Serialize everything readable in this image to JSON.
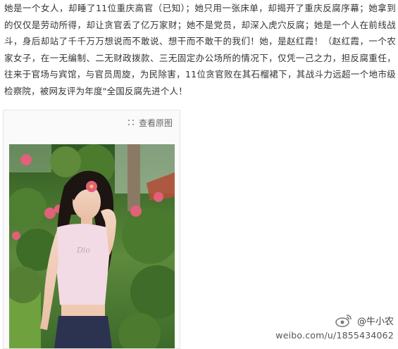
{
  "article": {
    "text": "她是一个女人，却睡了11位重庆高官（已知）；她只用一张床单，却揭开了重庆反腐序幕；她拿到的仅仅是劳动所得，却让贪官丢了亿万家财；她不是党员，却深入虎穴反腐；她是一个人在前线战斗，身后却站了千千万万想说而不敢说、想干而不敢干的我们！她，是赵红霞！（赵红霞，一个农家女子，在一无编制、二无财政拨款、三无固定办公场所的情况下，仅凭一己之力，担反腐重任，往来于官场与宾馆，与官员周旋，为民除害，11位贪官败在其石榴裙下，其战斗力远超一个地市级检察院，被网友评为年度\"全国反腐先进个人！"
  },
  "photo_card": {
    "view_original_label": "查看原图",
    "view_original_icon": "zoom-dots-icon",
    "photo_shirt_text": "Dio"
  },
  "watermark": {
    "handle": "@牛小农",
    "url": "weibo.com/u/1855434062",
    "logo_icon": "weibo-logo-icon"
  },
  "colors": {
    "text": "#333333",
    "card_border": "#e4e4e4",
    "card_bg": "#fafafa",
    "foliage": "#3f6b2c",
    "flower": "#e2607a"
  }
}
